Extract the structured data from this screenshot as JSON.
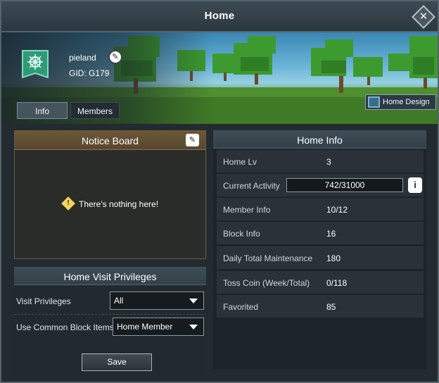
{
  "window": {
    "title": "Home"
  },
  "profile": {
    "username": "pieland",
    "gid": "GID: G179"
  },
  "tabs": [
    {
      "label": "Info",
      "active": true
    },
    {
      "label": "Members",
      "active": false
    }
  ],
  "home_design": {
    "label": "Home Design"
  },
  "notice_board": {
    "title": "Notice Board",
    "empty_text": "There's nothing here!"
  },
  "privileges": {
    "title": "Home Visit Privileges",
    "visit_label": "Visit Privileges",
    "visit_value": "All",
    "block_label": "Use Common Block Items",
    "block_value": "Home Member",
    "save_label": "Save"
  },
  "home_info": {
    "title": "Home Info",
    "rows": [
      {
        "label": "Home Lv",
        "value": "3"
      },
      {
        "label": "Current Activity",
        "value": "742/31000"
      },
      {
        "label": "Member Info",
        "value": "10/12"
      },
      {
        "label": "Block Info",
        "value": "16"
      },
      {
        "label": "Daily Total Maintenance",
        "value": "180"
      },
      {
        "label": "Toss Coin (Week/Total)",
        "value": "0/118"
      },
      {
        "label": "Favorited",
        "value": "85"
      }
    ]
  },
  "colors": {
    "emblem": "#2f9a78",
    "notice_header": "#6b5838",
    "panel_header": "#3e4d56",
    "warning": "#f4d35a"
  },
  "icons": {
    "close": "close-icon",
    "edit": "edit-icon",
    "emblem": "home-emblem-icon",
    "warning": "warning-icon",
    "info": "info-icon",
    "design": "home-design-icon",
    "dropdown": "chevron-down-icon"
  }
}
